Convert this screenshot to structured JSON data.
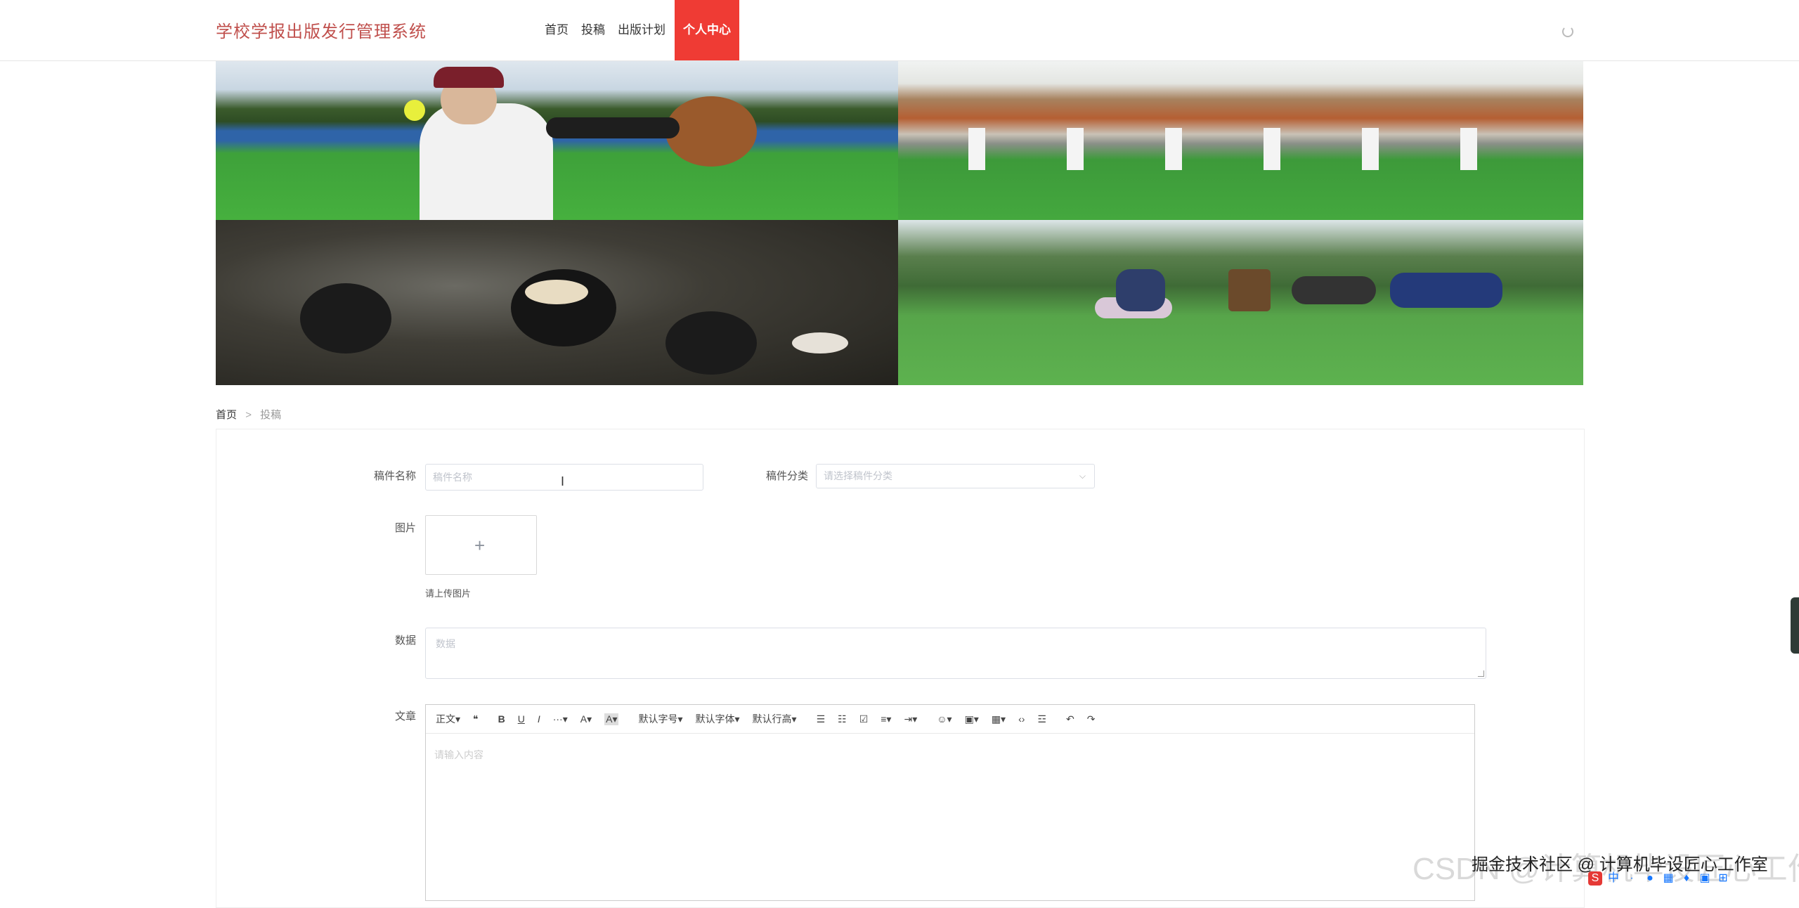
{
  "header": {
    "title": "学校学报出版发行管理系统",
    "nav": [
      {
        "label": "首页"
      },
      {
        "label": "投稿"
      },
      {
        "label": "出版计划"
      },
      {
        "label": "个人中心"
      }
    ]
  },
  "breadcrumb": {
    "home": "首页",
    "separator": ">",
    "current": "投稿"
  },
  "form": {
    "name_label": "稿件名称",
    "name_placeholder": "稿件名称",
    "category_label": "稿件分类",
    "category_placeholder": "请选择稿件分类",
    "image_label": "图片",
    "image_hint": "请上传图片",
    "data_label": "数据",
    "data_placeholder": "数据",
    "article_label": "文章",
    "editor_placeholder": "请输入内容"
  },
  "editor_toolbar": [
    "正文▾",
    "❝",
    "B",
    "U",
    "I",
    "···▾",
    "A▾",
    "A▾",
    "默认字号▾",
    "默认字体▾",
    "默认行高▾",
    "☰",
    "☷",
    "☑",
    "≡▾",
    "⇥▾",
    "☺▾",
    "▣▾",
    "▦▾",
    "‹›",
    "☲",
    "↶",
    "↷"
  ],
  "overlay": {
    "watermark": "CSDN @计算机毕设匠心工作室",
    "caption": "掘金技术社区 @ 计算机毕设匠心工作室"
  },
  "colors": {
    "brand": "#c0504d",
    "active_nav": "#ef3b34"
  }
}
